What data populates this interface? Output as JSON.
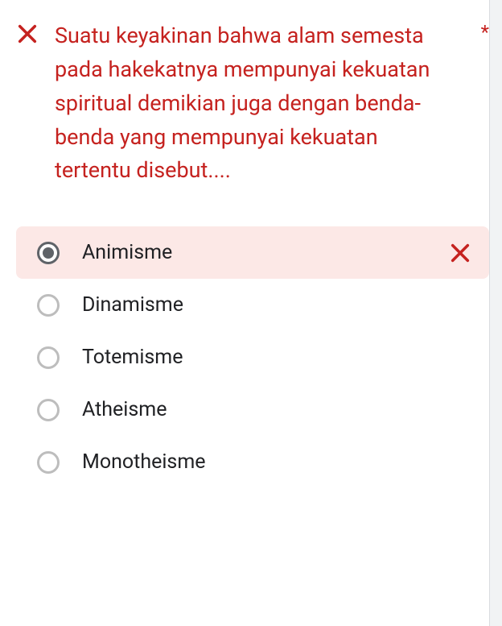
{
  "question": {
    "status": "incorrect",
    "text": "Suatu keyakinan bahwa alam semesta pada hakekatnya mempunyai kekuatan spiritual demikian juga dengan benda-benda yang mempunyai kekuatan tertentu disebut....",
    "required_marker": "*"
  },
  "options": [
    {
      "label": "Animisme",
      "selected": true,
      "marked_wrong": true
    },
    {
      "label": "Dinamisme",
      "selected": false,
      "marked_wrong": false
    },
    {
      "label": "Totemisme",
      "selected": false,
      "marked_wrong": false
    },
    {
      "label": "Atheisme",
      "selected": false,
      "marked_wrong": false
    },
    {
      "label": "Monotheisme",
      "selected": false,
      "marked_wrong": false
    }
  ],
  "colors": {
    "error": "#c5221f",
    "selected_bg": "#fce8e6",
    "radio_unselected": "#bdbdbd",
    "radio_selected": "#5f6368"
  }
}
